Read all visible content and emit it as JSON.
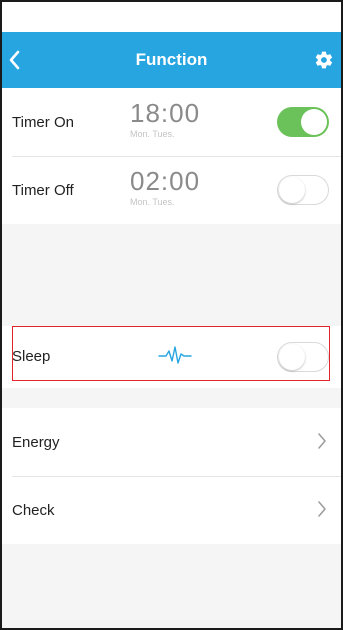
{
  "header": {
    "title": "Function",
    "back_icon": "chevron-left-icon",
    "settings_icon": "gear-icon",
    "bg_color": "#27a5e1"
  },
  "timers": [
    {
      "label": "Timer On",
      "time": "18:00",
      "days": "Mon. Tues.",
      "enabled": true
    },
    {
      "label": "Timer Off",
      "time": "02:00",
      "days": "Mon. Tues.",
      "enabled": false
    }
  ],
  "sleep": {
    "label": "Sleep",
    "icon": "sleep-pulse-icon",
    "enabled": false,
    "highlight_color": "#e2232a"
  },
  "menu": [
    {
      "label": "Energy",
      "icon": "chevron-right-icon"
    },
    {
      "label": "Check",
      "icon": "chevron-right-icon"
    }
  ],
  "colors": {
    "toggle_on": "#6cc25a",
    "accent": "#27a5e1"
  }
}
